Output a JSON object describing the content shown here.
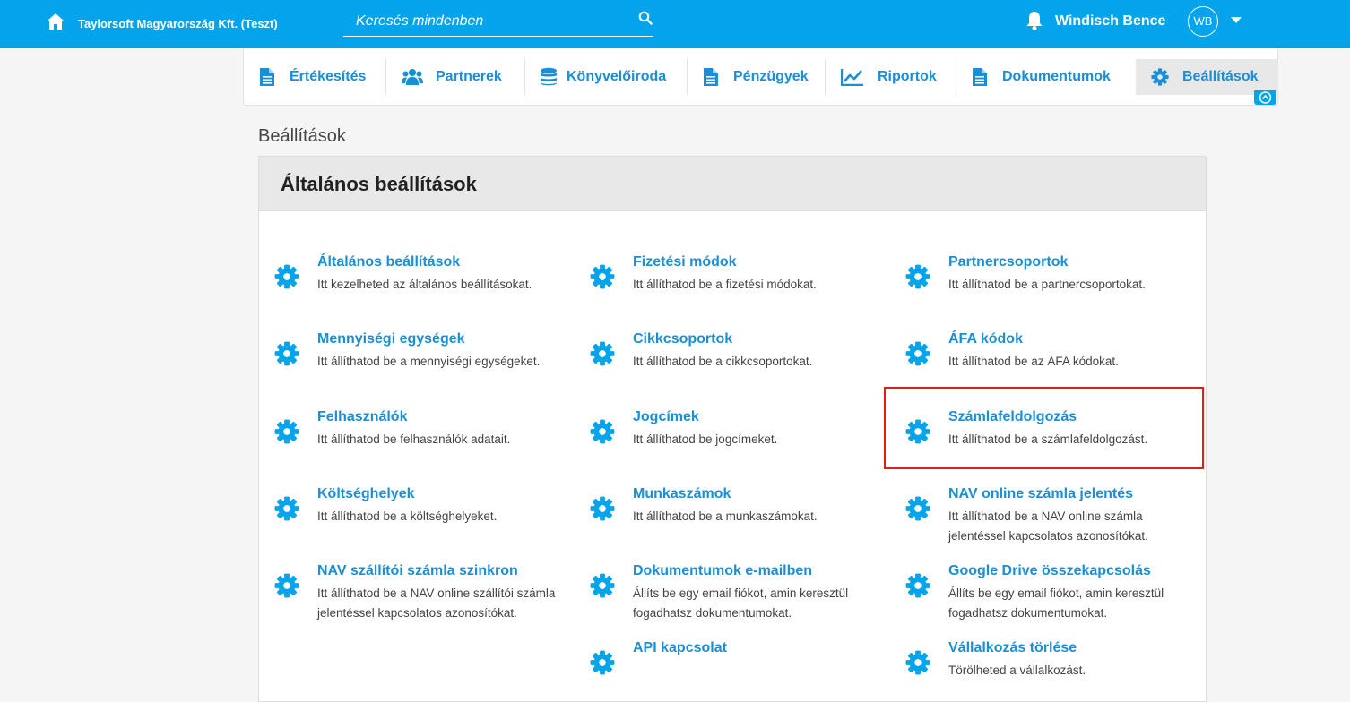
{
  "topbar": {
    "company": "Taylorsoft Magyarország Kft. (Teszt)",
    "search_placeholder": "Keresés mindenben",
    "username": "Windisch Bence",
    "avatar_initials": "WB"
  },
  "nav": {
    "items": [
      {
        "label": "Értékesítés",
        "icon": "document-icon"
      },
      {
        "label": "Partnerek",
        "icon": "users-icon"
      },
      {
        "label": "Könyvelőiroda",
        "icon": "database-icon"
      },
      {
        "label": "Pénzügyek",
        "icon": "document-icon"
      },
      {
        "label": "Riportok",
        "icon": "line-chart-icon"
      },
      {
        "label": "Dokumentumok",
        "icon": "document-icon"
      },
      {
        "label": "Beállítások",
        "icon": "gear-icon",
        "active": true
      }
    ]
  },
  "breadcrumb": "Beállítások",
  "panel": {
    "title": "Általános beállítások",
    "settings": [
      {
        "title": "Általános beállítások",
        "desc": "Itt kezelheted az általános beállításokat."
      },
      {
        "title": "Fizetési módok",
        "desc": "Itt állíthatod be a fizetési módokat."
      },
      {
        "title": "Partnercsoportok",
        "desc": "Itt állíthatod be a partnercsoportokat."
      },
      {
        "title": "Mennyiségi egységek",
        "desc": "Itt állíthatod be a mennyiségi egységeket."
      },
      {
        "title": "Cikkcsoportok",
        "desc": "Itt állíthatod be a cikkcsoportokat."
      },
      {
        "title": "ÁFA kódok",
        "desc": "Itt állíthatod be az ÁFA kódokat."
      },
      {
        "title": "Felhasználók",
        "desc": "Itt állíthatod be felhasználók adatait."
      },
      {
        "title": "Jogcímek",
        "desc": "Itt állíthatod be jogcímeket."
      },
      {
        "title": "Számlafeldolgozás",
        "desc": "Itt állíthatod be a számlafeldolgozást."
      },
      {
        "title": "Költséghelyek",
        "desc": "Itt állíthatod be a költséghelyeket."
      },
      {
        "title": "Munkaszámok",
        "desc": "Itt állíthatod be a munkaszámokat."
      },
      {
        "title": "NAV online számla jelentés",
        "desc": "Itt állíthatod be a NAV online számla jelentéssel kapcsolatos azonosítókat."
      },
      {
        "title": "NAV szállítói számla szinkron",
        "desc": "Itt állíthatod be a NAV online szállítói számla jelentéssel kapcsolatos azonosítókat."
      },
      {
        "title": "Dokumentumok e-mailben",
        "desc": "Állíts be egy email fiókot, amin keresztül fogadhatsz dokumentumokat."
      },
      {
        "title": "Google Drive összekapcsolás",
        "desc": "Állíts be egy email fiókot, amin keresztül fogadhatsz dokumentumokat."
      },
      {
        "title": "API kapcsolat",
        "desc": ""
      },
      {
        "title": "Vállalkozás törlése",
        "desc": "Törölheted a vállalkozást."
      }
    ]
  },
  "colors": {
    "accent": "#03a4ec",
    "link": "#1a8fd6",
    "highlight": "#e31b1b"
  }
}
